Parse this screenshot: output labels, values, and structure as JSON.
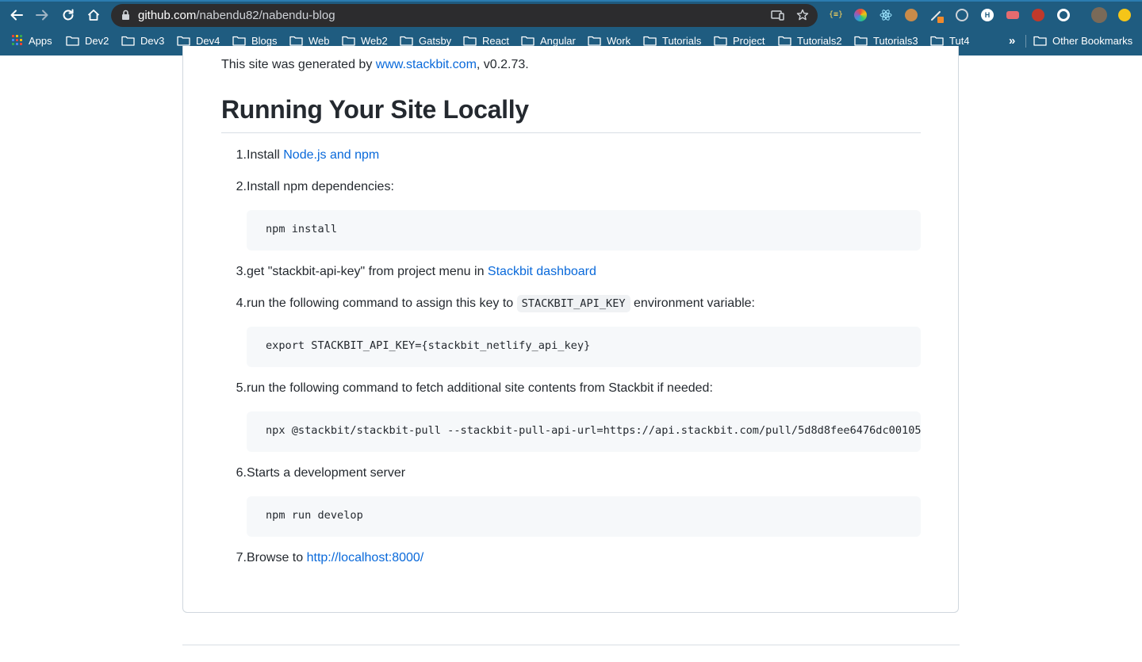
{
  "browser": {
    "url_host": "github.com",
    "url_path": "/nabendu82/nabendu-blog",
    "bookmarks": [
      {
        "label": "Apps",
        "icon": "apps-grid-icon"
      },
      {
        "label": "Dev2",
        "icon": "folder-icon"
      },
      {
        "label": "Dev3",
        "icon": "folder-icon"
      },
      {
        "label": "Dev4",
        "icon": "folder-icon"
      },
      {
        "label": "Blogs",
        "icon": "folder-icon"
      },
      {
        "label": "Web",
        "icon": "folder-icon"
      },
      {
        "label": "Web2",
        "icon": "folder-icon"
      },
      {
        "label": "Gatsby",
        "icon": "folder-icon"
      },
      {
        "label": "React",
        "icon": "folder-icon"
      },
      {
        "label": "Angular",
        "icon": "folder-icon"
      },
      {
        "label": "Work",
        "icon": "folder-icon"
      },
      {
        "label": "Tutorials",
        "icon": "folder-icon"
      },
      {
        "label": "Project",
        "icon": "folder-icon"
      },
      {
        "label": "Tutorials2",
        "icon": "folder-icon"
      },
      {
        "label": "Tutorials3",
        "icon": "folder-icon"
      },
      {
        "label": "Tut4",
        "icon": "folder-icon"
      }
    ],
    "overflow_label": "»",
    "other_bookmarks": "Other Bookmarks",
    "colors": {
      "chrome": "#1f5c80",
      "omnibox": "#2c2c2e"
    }
  },
  "readme": {
    "generated_prefix": "This site was generated by ",
    "generated_link": "www.stackbit.com",
    "generated_suffix": ", v0.2.73.",
    "heading": "Running Your Site Locally",
    "steps": [
      {
        "num": "1.",
        "prefix": "Install ",
        "link": "Node.js and npm"
      },
      {
        "num": "2.",
        "text": "Install npm dependencies:",
        "code": "npm install"
      },
      {
        "num": "3.",
        "prefix": "get \"stackbit-api-key\" from project menu in ",
        "link": "Stackbit dashboard"
      },
      {
        "num": "4.",
        "prefix": "run the following command to assign this key to ",
        "inline_code": "STACKBIT_API_KEY",
        "suffix": " environment variable:",
        "code": "export STACKBIT_API_KEY={stackbit_netlify_api_key}"
      },
      {
        "num": "5.",
        "text": "run the following command to fetch additional site contents from Stackbit if needed:",
        "code": "npx @stackbit/stackbit-pull --stackbit-pull-api-url=https://api.stackbit.com/pull/5d8d8fee6476dc00105"
      },
      {
        "num": "6.",
        "text": "Starts a development server",
        "code": "npm run develop"
      },
      {
        "num": "7.",
        "prefix": "Browse to ",
        "link": "http://localhost:8000/"
      }
    ],
    "link_color": "#0969da"
  }
}
